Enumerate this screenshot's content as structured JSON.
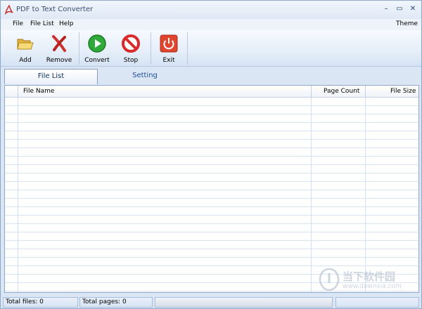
{
  "window": {
    "title": "PDF to Text Converter",
    "minimize_glyph": "–",
    "restore_glyph": "▭",
    "close_glyph": "✕"
  },
  "menu": {
    "file": "File",
    "file_list": "File List",
    "help": "Help",
    "theme": "Theme"
  },
  "toolbar": {
    "add": "Add",
    "remove": "Remove",
    "convert": "Convert",
    "stop": "Stop",
    "exit": "Exit"
  },
  "icons": {
    "app": "pdf-logo-icon",
    "add": "folder-open-icon",
    "remove": "red-x-icon",
    "convert": "play-icon",
    "stop": "stop-sign-icon",
    "exit": "power-icon"
  },
  "tabs": [
    {
      "label": "File List",
      "active": true
    },
    {
      "label": "Setting",
      "active": false
    }
  ],
  "table": {
    "columns": [
      "File Name",
      "Page Count",
      "File Size"
    ],
    "rows": []
  },
  "status": {
    "total_files": "Total files: 0",
    "total_pages": "Total pages: 0",
    "progress": 0
  },
  "watermark": {
    "text": "当下软件园",
    "sub": "www.downxia.com"
  },
  "colors": {
    "accent": "#1d4f96",
    "chrome": "#dbe6f4",
    "grid_line": "#d8e5f7"
  }
}
